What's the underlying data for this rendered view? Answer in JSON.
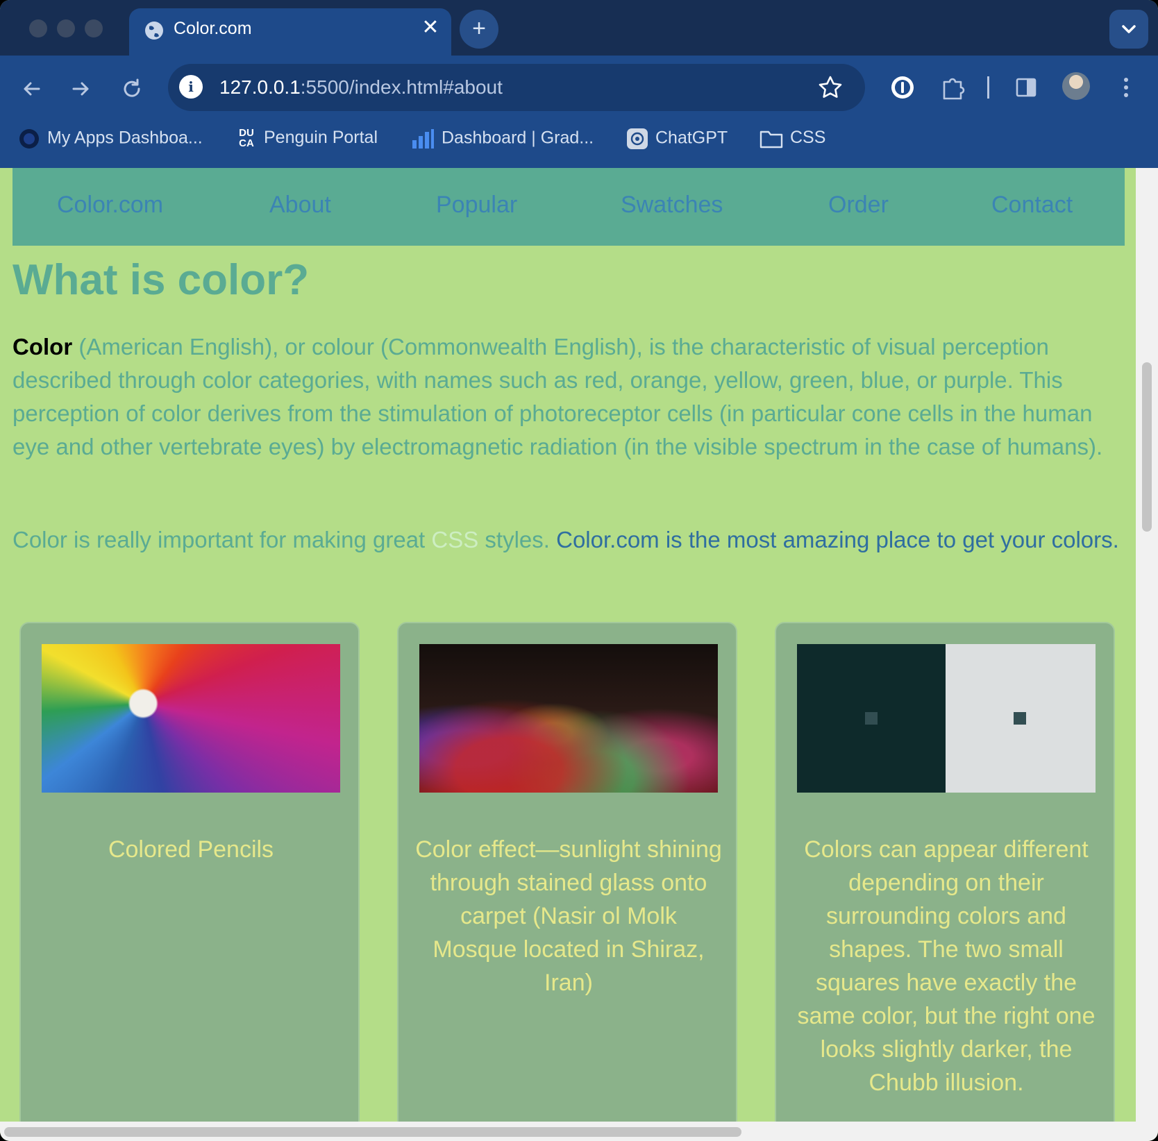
{
  "browser": {
    "tab_title": "Color.com",
    "new_tab_symbol": "+",
    "close_symbol": "✕",
    "url_host": "127.0.0.1",
    "url_rest": ":5500/index.html#about",
    "bookmarks": [
      {
        "label": "My Apps Dashboa...",
        "icon": "circle-icon"
      },
      {
        "label": "Penguin Portal",
        "icon": "duca-icon"
      },
      {
        "label": "Dashboard | Grad...",
        "icon": "bar-chart-icon"
      },
      {
        "label": "ChatGPT",
        "icon": "chatgpt-icon"
      },
      {
        "label": "CSS",
        "icon": "folder-icon"
      }
    ],
    "penguin_icon_text": [
      "DU",
      "CA"
    ]
  },
  "nav": {
    "items": [
      "Color.com",
      "About",
      "Popular",
      "Swatches",
      "Order",
      "Contact"
    ]
  },
  "about": {
    "heading": "What is color?",
    "intro_bold": "Color",
    "intro_rest": " (American English), or colour (Commonwealth English), is the characteristic of visual perception described through color categories, with names such as red, orange, yellow, green, blue, or purple. This perception of color derives from the stimulation of photoreceptor cells (in particular cone cells in the human eye and other vertebrate eyes) by electromagnetic radiation (in the visible spectrum in the case of humans).",
    "line2_a": "Color is really important for making great ",
    "line2_css": "CSS",
    "line2_b": " styles. ",
    "line2_strong": "Color.com is the most amazing place to get your colors."
  },
  "cards": [
    {
      "caption": "Colored Pencils"
    },
    {
      "caption": "Color effect—sunlight shining through stained glass onto carpet (Nasir ol Molk Mosque located in Shiraz, Iran)"
    },
    {
      "caption": "Colors can appear different depending on their surrounding colors and shapes. The two small squares have exactly the same color, but the right one looks slightly darker, the Chubb illusion."
    }
  ],
  "colors": {
    "nav_bg": "#5aab93",
    "page_bg": "#b4dd88",
    "card_bg": "#8bb28a",
    "caption": "#e6e88b",
    "chrome_dark": "#172e53",
    "chrome": "#1e4a8a"
  }
}
